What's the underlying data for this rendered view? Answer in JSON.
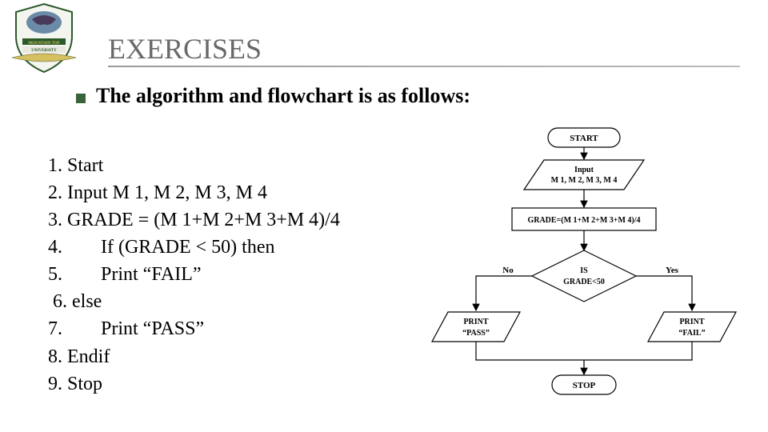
{
  "title": "EXERCISES",
  "subtitle": "The algorithm and flowchart is as follows:",
  "algorithm": {
    "s1": "1. Start",
    "s2": "2. Input M 1, M 2, M 3, M 4",
    "s3": "3. GRADE = (M 1+M 2+M 3+M 4)/4",
    "s4": "4.        If (GRADE < 50) then",
    "s5": "5.        Print “FAIL”",
    "s6": " 6. else",
    "s7": "7.        Print “PASS”",
    "s8": "8. Endif",
    "s9": "9. Stop"
  },
  "flowchart": {
    "start": "START",
    "input_l1": "Input",
    "input_l2": "M 1, M 2, M 3, M 4",
    "process": "GRADE=(M 1+M 2+M 3+M 4)/4",
    "decision_l1": "IS",
    "decision_l2": "GRADE<50",
    "no": "No",
    "yes": "Yes",
    "print_pass_l1": "PRINT",
    "print_pass_l2": "“PASS”",
    "print_fail_l1": "PRINT",
    "print_fail_l2": "“FAIL”",
    "stop": "STOP"
  }
}
